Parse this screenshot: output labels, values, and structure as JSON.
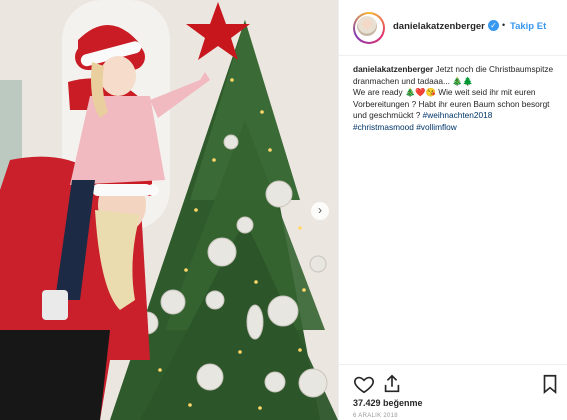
{
  "post": {
    "username": "danielakatzenberger",
    "follow_label": "Takip Et",
    "separator": "•",
    "verified_glyph": "✓",
    "caption_user": "danielakatzenberger",
    "caption_line1": " Jetzt noch die Christbaumspitze dranmachen und tadaaa... 🎄🌲",
    "caption_line2": "We are ready 🎄❤️😘 Wie weit seid ihr mit euren Vorbereitungen ? Habt ihr euren Baum schon besorgt und geschmückt ?",
    "hashtag1": "#weihnachten2018",
    "hashtag2": "#christmasmood",
    "hashtag3": "#vollimflow",
    "likes": "37.429 beğenme",
    "date": "6 ARALIK 2018"
  },
  "photo": {
    "next_arrow": "›",
    "alt_scene": "Mother and daughter in Santa hats decorating a Christmas tree"
  },
  "icons": {
    "like": "heart-icon",
    "share": "share-icon",
    "save": "bookmark-icon"
  },
  "colors": {
    "accent": "#3897f0",
    "text": "#262626",
    "hashtag": "#003569"
  }
}
